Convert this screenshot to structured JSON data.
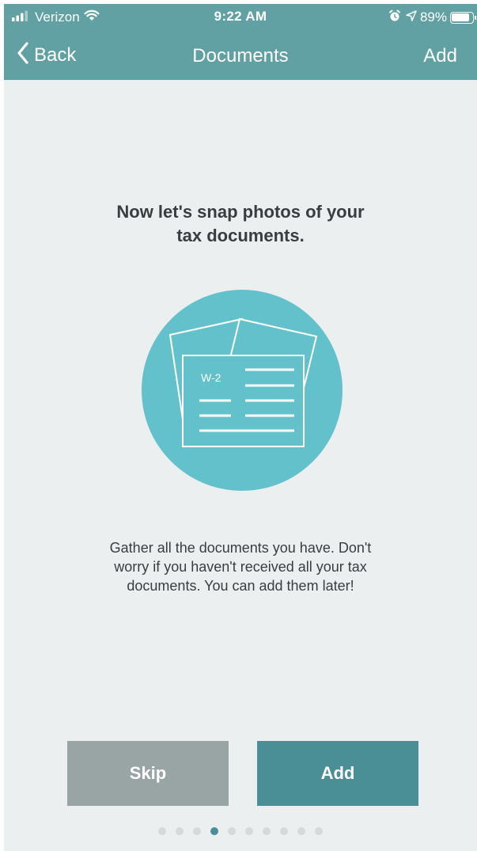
{
  "status_bar": {
    "carrier": "Verizon",
    "time": "9:22 AM",
    "battery_percent": "89%",
    "battery_level": 0.89,
    "icons": [
      "signal-icon",
      "wifi-icon",
      "alarm-icon",
      "location-icon",
      "battery-icon"
    ]
  },
  "nav": {
    "back_label": "Back",
    "title": "Documents",
    "add_label": "Add"
  },
  "main": {
    "headline_lines": [
      "Now let's snap photos of your",
      "tax documents."
    ],
    "illustration_label": "W-2",
    "description_lines": [
      "Gather all the documents you have. Don't",
      "worry if you haven't received all your tax",
      "documents. You can add them later!"
    ]
  },
  "buttons": {
    "skip": "Skip",
    "add": "Add"
  },
  "pager": {
    "total": 10,
    "current": 4
  },
  "colors": {
    "header_bg": "#62a1a3",
    "page_bg": "#ebeff0",
    "illustration_circle": "#63c1cb",
    "skip_button": "#99a4a5",
    "add_button": "#4a8f96",
    "active_dot": "#4a8f96",
    "inactive_dot": "#d6d9da"
  }
}
